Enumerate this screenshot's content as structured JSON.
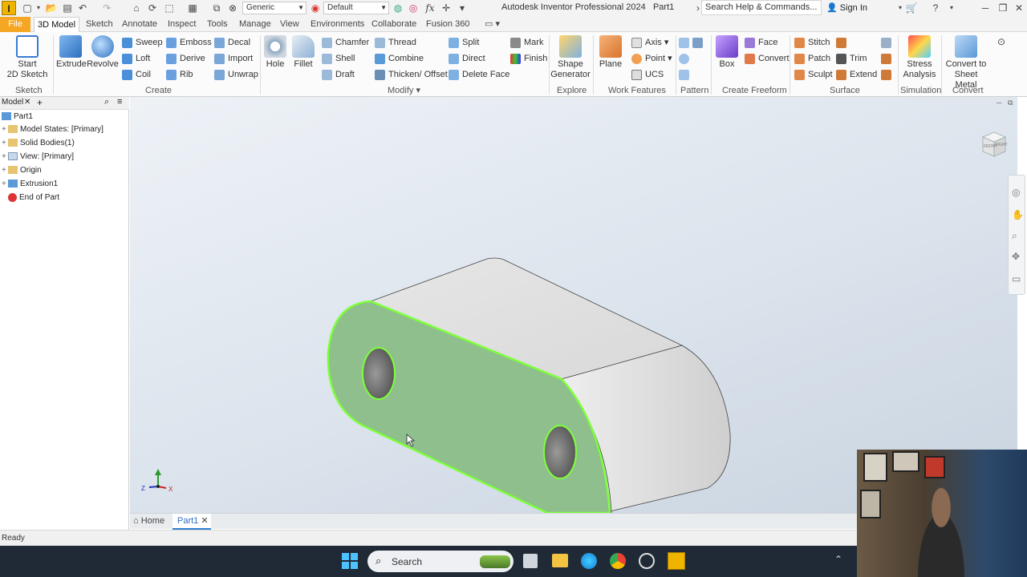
{
  "qat": {
    "logo": "I",
    "material_combo": "Generic",
    "appearance_combo": "Default",
    "fx": "fx",
    "title": "Autodesk Inventor Professional 2024",
    "doc": "Part1",
    "search_placeholder": "Search Help & Commands...",
    "signin": "Sign In"
  },
  "tabs": [
    "File",
    "3D Model",
    "Sketch",
    "Annotate",
    "Inspect",
    "Tools",
    "Manage",
    "View",
    "Environments",
    "Collaborate",
    "Fusion 360"
  ],
  "active_tab": "3D Model",
  "ribbon": {
    "sketch": {
      "start1": "Start",
      "start2": "2D Sketch",
      "group": "Sketch"
    },
    "create": {
      "extrude": "Extrude",
      "revolve": "Revolve",
      "sweep": "Sweep",
      "loft": "Loft",
      "coil": "Coil",
      "emboss": "Emboss",
      "derive": "Derive",
      "rib": "Rib",
      "decal": "Decal",
      "import": "Import",
      "unwrap": "Unwrap",
      "group": "Create"
    },
    "modify": {
      "hole": "Hole",
      "fillet": "Fillet",
      "chamfer": "Chamfer",
      "shell": "Shell",
      "draft": "Draft",
      "thread": "Thread",
      "combine": "Combine",
      "thicken": "Thicken/ Offset",
      "split": "Split",
      "direct": "Direct",
      "delete_face": "Delete Face",
      "mark": "Mark",
      "finish": "Finish",
      "group": "Modify"
    },
    "explore": {
      "shape1": "Shape",
      "shape2": "Generator",
      "group": "Explore"
    },
    "work": {
      "plane": "Plane",
      "axis": "Axis",
      "point": "Point",
      "ucs": "UCS",
      "group": "Work Features"
    },
    "pattern": {
      "group": "Pattern"
    },
    "freeform": {
      "box": "Box",
      "face": "Face",
      "convert": "Convert",
      "group": "Create Freeform"
    },
    "surface": {
      "stitch": "Stitch",
      "patch": "Patch",
      "sculpt": "Sculpt",
      "trim": "Trim",
      "extend": "Extend",
      "group": "Surface"
    },
    "simulation": {
      "stress1": "Stress",
      "stress2": "Analysis",
      "group": "Simulation"
    },
    "convert": {
      "c1": "Convert to",
      "c2": "Sheet Metal",
      "group": "Convert"
    }
  },
  "browser": {
    "tab": "Model",
    "root": "Part1",
    "items": [
      "Model States: [Primary]",
      "Solid Bodies(1)",
      "View: [Primary]",
      "Origin",
      "Extrusion1",
      "End of Part"
    ]
  },
  "viewcube": {
    "left": "FRONT",
    "right": "RIGHT"
  },
  "doctabs": {
    "home": "Home",
    "part": "Part1"
  },
  "status": "Ready",
  "taskbar": {
    "search": "Search"
  },
  "colors": {
    "accent": "#f5a623",
    "selection": "#7dff3a",
    "face_selected": "#8fbf8c",
    "body": "#dcdcdc"
  }
}
